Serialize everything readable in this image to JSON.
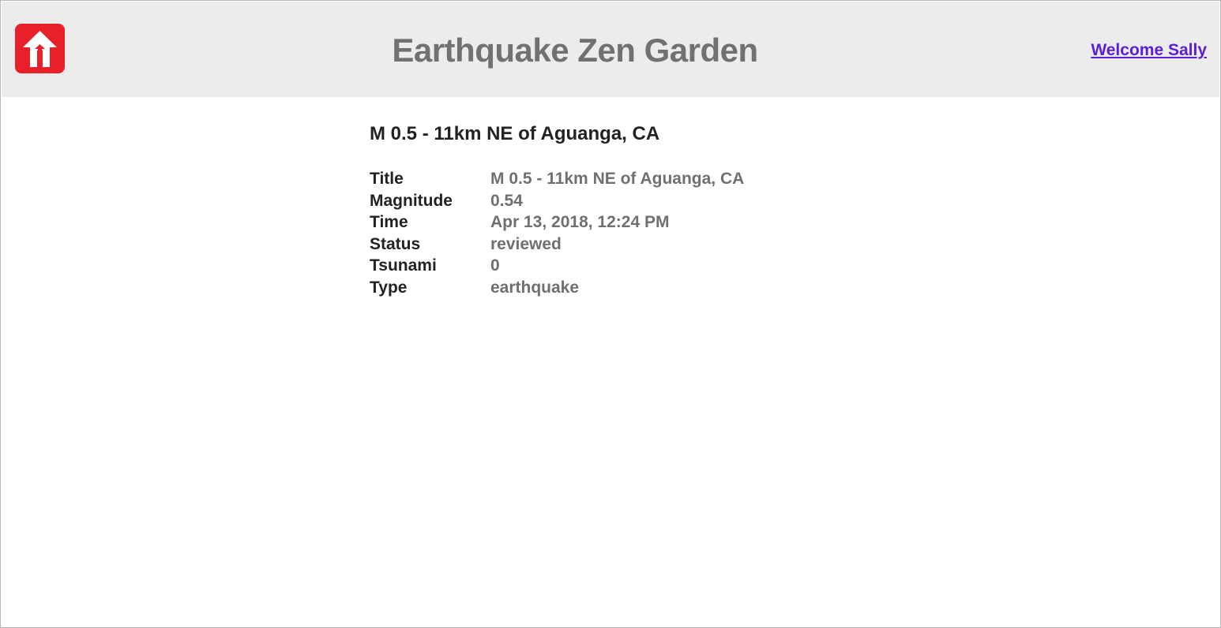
{
  "header": {
    "logo_icon": "home-arrow-icon",
    "title": "Earthquake Zen Garden",
    "welcome_link": "Welcome Sally"
  },
  "detail": {
    "heading": "M 0.5 - 11km NE of Aguanga, CA",
    "rows": [
      {
        "key": "Title",
        "value": "M 0.5 - 11km NE of Aguanga, CA"
      },
      {
        "key": "Magnitude",
        "value": "0.54"
      },
      {
        "key": "Time",
        "value": "Apr 13, 2018, 12:24 PM"
      },
      {
        "key": "Status",
        "value": "reviewed"
      },
      {
        "key": "Tsunami",
        "value": "0"
      },
      {
        "key": "Type",
        "value": "earthquake"
      }
    ]
  },
  "colors": {
    "header_bg": "#ececec",
    "logo_red": "#e8202a",
    "title_gray": "#717171",
    "link_purple": "#5a1fd6"
  }
}
